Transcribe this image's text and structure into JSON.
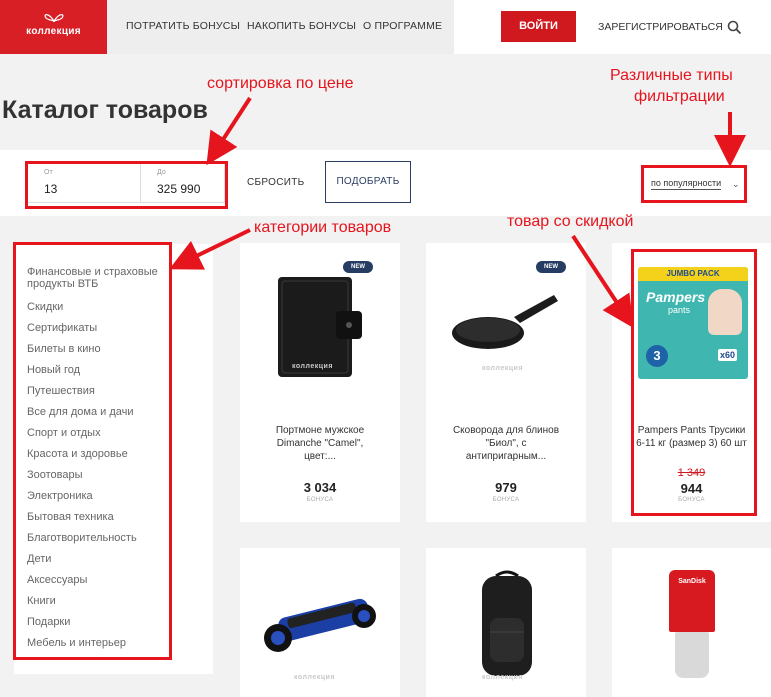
{
  "brand": {
    "name": "коллекция",
    "color": "#d81f26"
  },
  "nav": {
    "items": [
      "ПОТРАТИТЬ БОНУСЫ",
      "НАКОПИТЬ БОНУСЫ",
      "О ПРОГРАММЕ"
    ],
    "login_label": "ВОЙТИ",
    "register_label": "ЗАРЕГИСТРИРОВАТЬСЯ",
    "search_icon": "search-icon"
  },
  "page": {
    "title": "Каталог товаров"
  },
  "filter": {
    "from_label": "От",
    "from_value": "13",
    "to_label": "До",
    "to_value": "325 990",
    "reset_label": "СБРОСИТЬ",
    "apply_label": "ПОДОБРАТЬ",
    "sort_value": "по популярности"
  },
  "categories": [
    "Финансовые и страховые продукты ВТБ",
    "Скидки",
    "Сертификаты",
    "Билеты в кино",
    "Новый год",
    "Путешествия",
    "Все для дома и дачи",
    "Спорт и отдых",
    "Красота и здоровье",
    "Зоотовары",
    "Электроника",
    "Бытовая техника",
    "Благотворительность",
    "Дети",
    "Аксессуары",
    "Книги",
    "Подарки",
    "Мебель и интерьер"
  ],
  "products": [
    {
      "badge": "NEW",
      "name": "Портмоне мужское Dimanche \"Camel\", цвет:...",
      "old_price": "",
      "price": "3 034",
      "unit": "БОНУСА",
      "watermark": "коллекция"
    },
    {
      "badge": "NEW",
      "name": "Сковорода для блинов \"Биол\", с антипригарным...",
      "old_price": "",
      "price": "979",
      "unit": "БОНУСА",
      "watermark": "коллекция"
    },
    {
      "badge": "",
      "name": "Pampers Pants Трусики 6-11 кг (размер 3) 60 шт",
      "old_price": "1 349",
      "price": "944",
      "unit": "БОНУСА",
      "pack_top": "JUMBO PACK",
      "pack_brand": "Pampers",
      "pack_sub": "pants",
      "pack_size": "3",
      "pack_count": "x60"
    },
    {
      "badge": "",
      "name": "",
      "old_price": "",
      "price": "",
      "unit": "",
      "watermark": "коллекция"
    },
    {
      "badge": "",
      "name": "",
      "old_price": "",
      "price": "",
      "unit": "",
      "watermark": "коллекция"
    },
    {
      "badge": "",
      "name": "",
      "old_price": "",
      "price": "",
      "unit": "",
      "logo_text": "SanDisk"
    }
  ],
  "annotations": {
    "color": "#e5141d",
    "price_sort": "сортировка по цене",
    "filter_types_line1": "Различные типы",
    "filter_types_line2": "фильтрации",
    "categories": "категории товаров",
    "discount_item": "товар со скидкой"
  }
}
